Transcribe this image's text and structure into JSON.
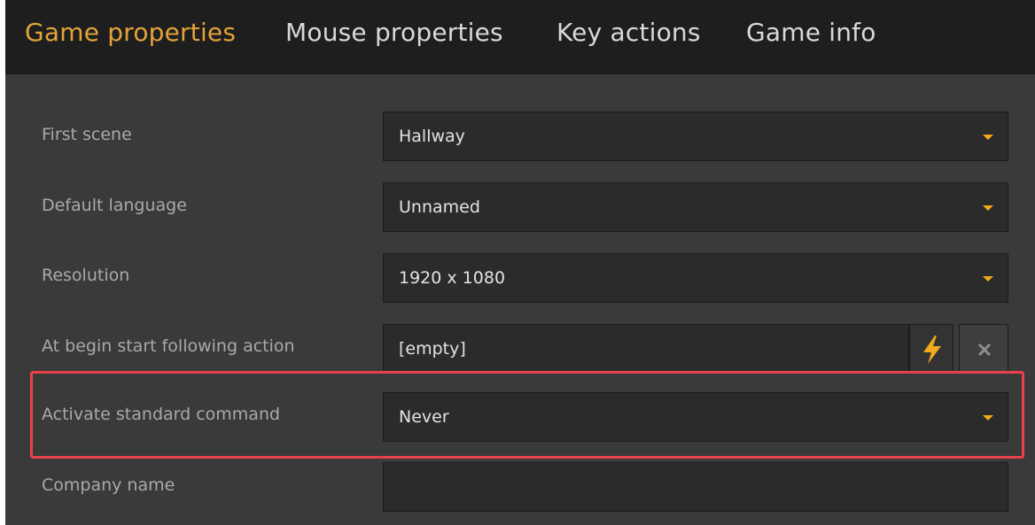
{
  "tabs": [
    {
      "label": "Game properties",
      "active": true
    },
    {
      "label": "Mouse properties",
      "active": false
    },
    {
      "label": "Key actions",
      "active": false
    },
    {
      "label": "Game info",
      "active": false
    }
  ],
  "form": {
    "first_scene": {
      "label": "First scene",
      "value": "Hallway"
    },
    "default_language": {
      "label": "Default language",
      "value": "Unnamed"
    },
    "resolution": {
      "label": "Resolution",
      "value": "1920 x 1080"
    },
    "begin_action": {
      "label": "At begin start following action",
      "value": "[empty]"
    },
    "standard_command": {
      "label": "Activate standard command",
      "value": "Never"
    },
    "company_name": {
      "label": "Company name",
      "value": ""
    }
  },
  "colors": {
    "accent": "#e3a33b",
    "caret": "#f2a91c",
    "highlight": "#e8414b",
    "panel_bg": "#3a3a3a",
    "tabbar_bg": "#1e1e1e"
  },
  "icons": {
    "dropdown": "chevron-down-icon",
    "action": "lightning-bolt-icon",
    "clear": "close-icon"
  }
}
